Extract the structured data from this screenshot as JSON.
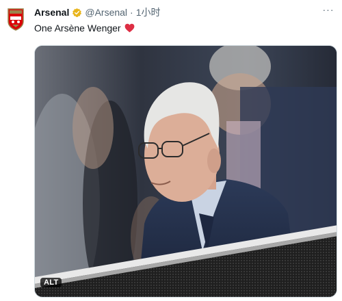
{
  "tweet": {
    "author_name": "Arsenal",
    "handle": "@Arsenal",
    "separator": "·",
    "time": "1小时",
    "more_label": "···",
    "text": "One Arsène Wenger",
    "avatar_icon": "arsenal-crest-icon",
    "verified_icon": "gold-verified-badge-icon",
    "emoji_icon": "red-heart-icon",
    "verified_color": "#e8b51c",
    "heart_color": "#dd2e44"
  },
  "media": {
    "alt_label": "ALT",
    "photo_subject": "photo"
  }
}
